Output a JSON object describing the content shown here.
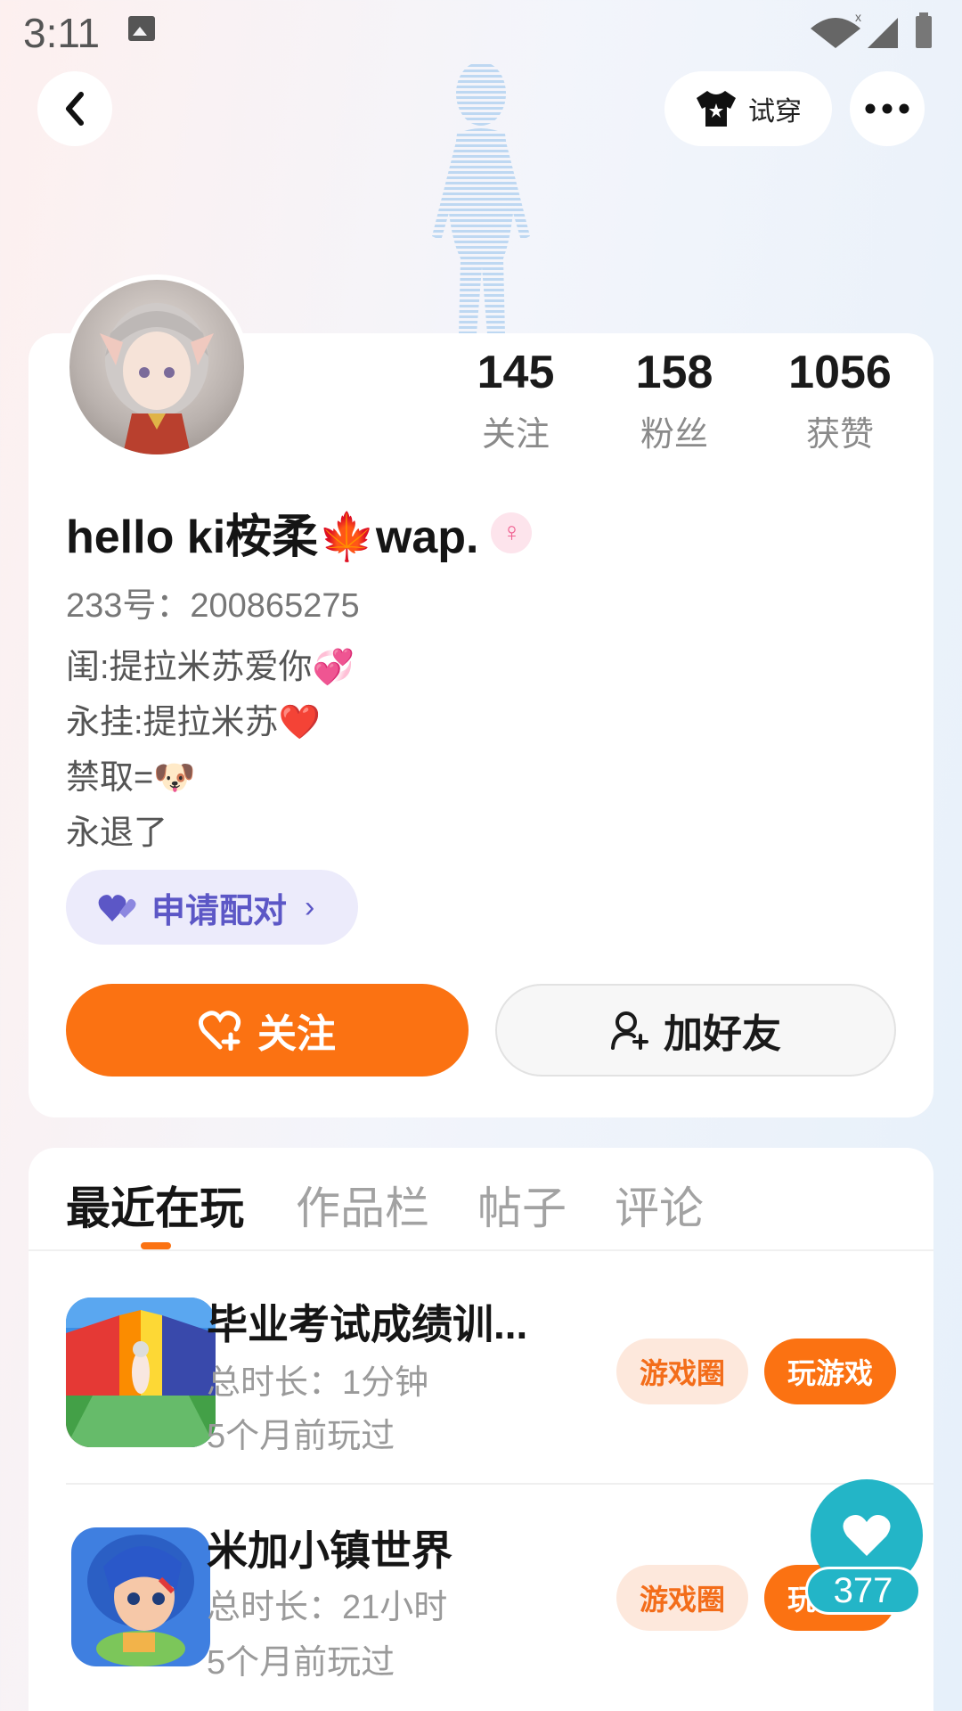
{
  "status_bar": {
    "time": "3:11"
  },
  "header": {
    "try_on_label": "试穿"
  },
  "profile": {
    "stats": [
      {
        "value": "145",
        "label": "关注"
      },
      {
        "value": "158",
        "label": "粉丝"
      },
      {
        "value": "1056",
        "label": "获赞"
      }
    ],
    "username": "hello ki桉柔🍁wap.",
    "gender_symbol": "♀",
    "uid": "233号：200865275",
    "bio": [
      "闺:提拉米苏爱你💞",
      "永挂:提拉米苏❤️",
      "禁取=🐶",
      "永退了"
    ],
    "match_label": "申请配对",
    "follow_label": "关注",
    "add_friend_label": "加好友"
  },
  "tabs": [
    {
      "label": "最近在玩",
      "active": true
    },
    {
      "label": "作品栏",
      "active": false
    },
    {
      "label": "帖子",
      "active": false
    },
    {
      "label": "评论",
      "active": false
    }
  ],
  "games": [
    {
      "title": "毕业考试成绩训...",
      "duration": "总时长：1分钟",
      "last_played": "5个月前玩过",
      "circle_label": "游戏圈",
      "play_label": "玩游戏"
    },
    {
      "title": "米加小镇世界",
      "duration": "总时长：21小时",
      "last_played": "5个月前玩过",
      "circle_label": "游戏圈",
      "play_label": "玩游戏"
    }
  ],
  "like_fab": {
    "count": "377"
  },
  "colors": {
    "accent": "#fb7212",
    "match": "#5c57c6",
    "fab": "#23b5c7"
  }
}
